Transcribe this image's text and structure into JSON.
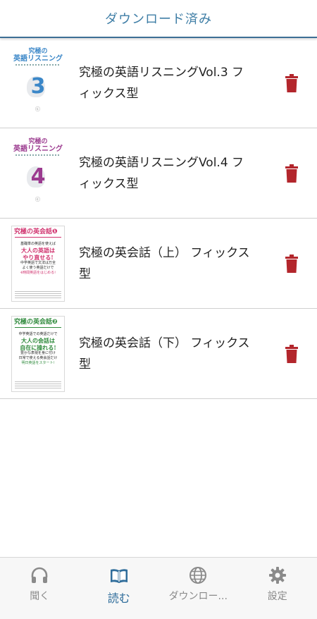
{
  "header": {
    "title": "ダウンロード済み"
  },
  "items": [
    {
      "title": "究極の英語リスニングVol.3 フィックス型",
      "thumb": {
        "line1": "究極の",
        "line2": "英語リスニング",
        "number": "3",
        "color": "#3b87c8",
        "logo": "ⓒ"
      }
    },
    {
      "title": "究極の英語リスニングVol.4 フィックス型",
      "thumb": {
        "line1": "究極の",
        "line2": "英語リスニング",
        "number": "4",
        "color": "#9b3a8f",
        "logo": "ⓒ"
      }
    },
    {
      "title": "究極の英会話（上） フィックス型",
      "thumb": {
        "title": "究極の英会話❶",
        "color": "#d0326e",
        "l1": "基礎単の英語を使えば",
        "l2": "大人の英語は",
        "l3": "やり直せる!",
        "l4": "中学英語で文法は万全",
        "l5": "よく使う英語だけで",
        "l6": "4時間英語をはじめる!"
      }
    },
    {
      "title": "究極の英会話（下） フィックス型",
      "thumb": {
        "title": "究極の英会話❷",
        "color": "#2f8a3c",
        "l1": "中学英語での英語だけで",
        "l2": "大人の会話は",
        "l3": "自在に操れる!",
        "l4": "豊かな表現を身に付け",
        "l5": "日常で使える英会話だけ",
        "l6": "明日英語をスタート!"
      }
    }
  ],
  "nav": [
    {
      "label": "聞く",
      "icon": "headphones-icon",
      "active": false
    },
    {
      "label": "読む",
      "icon": "book-icon",
      "active": true
    },
    {
      "label": "ダウンロー...",
      "icon": "globe-icon",
      "active": false
    },
    {
      "label": "設定",
      "icon": "gear-icon",
      "active": false
    }
  ],
  "colors": {
    "accent": "#2f6d9b",
    "trash": "#b3262c",
    "inactive": "#8a8a8a"
  }
}
